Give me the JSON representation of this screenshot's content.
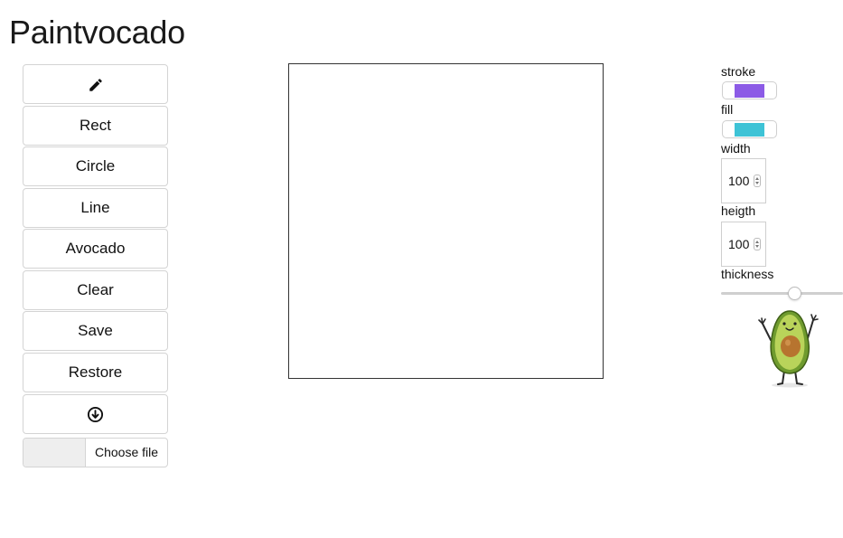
{
  "app": {
    "title": "Paintvocado"
  },
  "toolbar": {
    "items": [
      {
        "label": "",
        "icon": "pencil-icon"
      },
      {
        "label": "Rect"
      },
      {
        "label": "Circle"
      },
      {
        "label": "Line"
      },
      {
        "label": "Avocado"
      },
      {
        "label": "Clear"
      },
      {
        "label": "Save"
      },
      {
        "label": "Restore"
      },
      {
        "label": "",
        "icon": "download-circle-icon"
      }
    ],
    "file_input": {
      "button_label": "Choose file"
    }
  },
  "controls": {
    "stroke": {
      "label": "stroke",
      "color": "#8c5be6"
    },
    "fill": {
      "label": "fill",
      "color": "#3ec3d6"
    },
    "width": {
      "label": "width",
      "value": "100"
    },
    "height": {
      "label": "heigth",
      "value": "100"
    },
    "thickness": {
      "label": "thickness",
      "value": 0.6
    }
  },
  "mascot": {
    "icon": "avocado-mascot-icon"
  }
}
